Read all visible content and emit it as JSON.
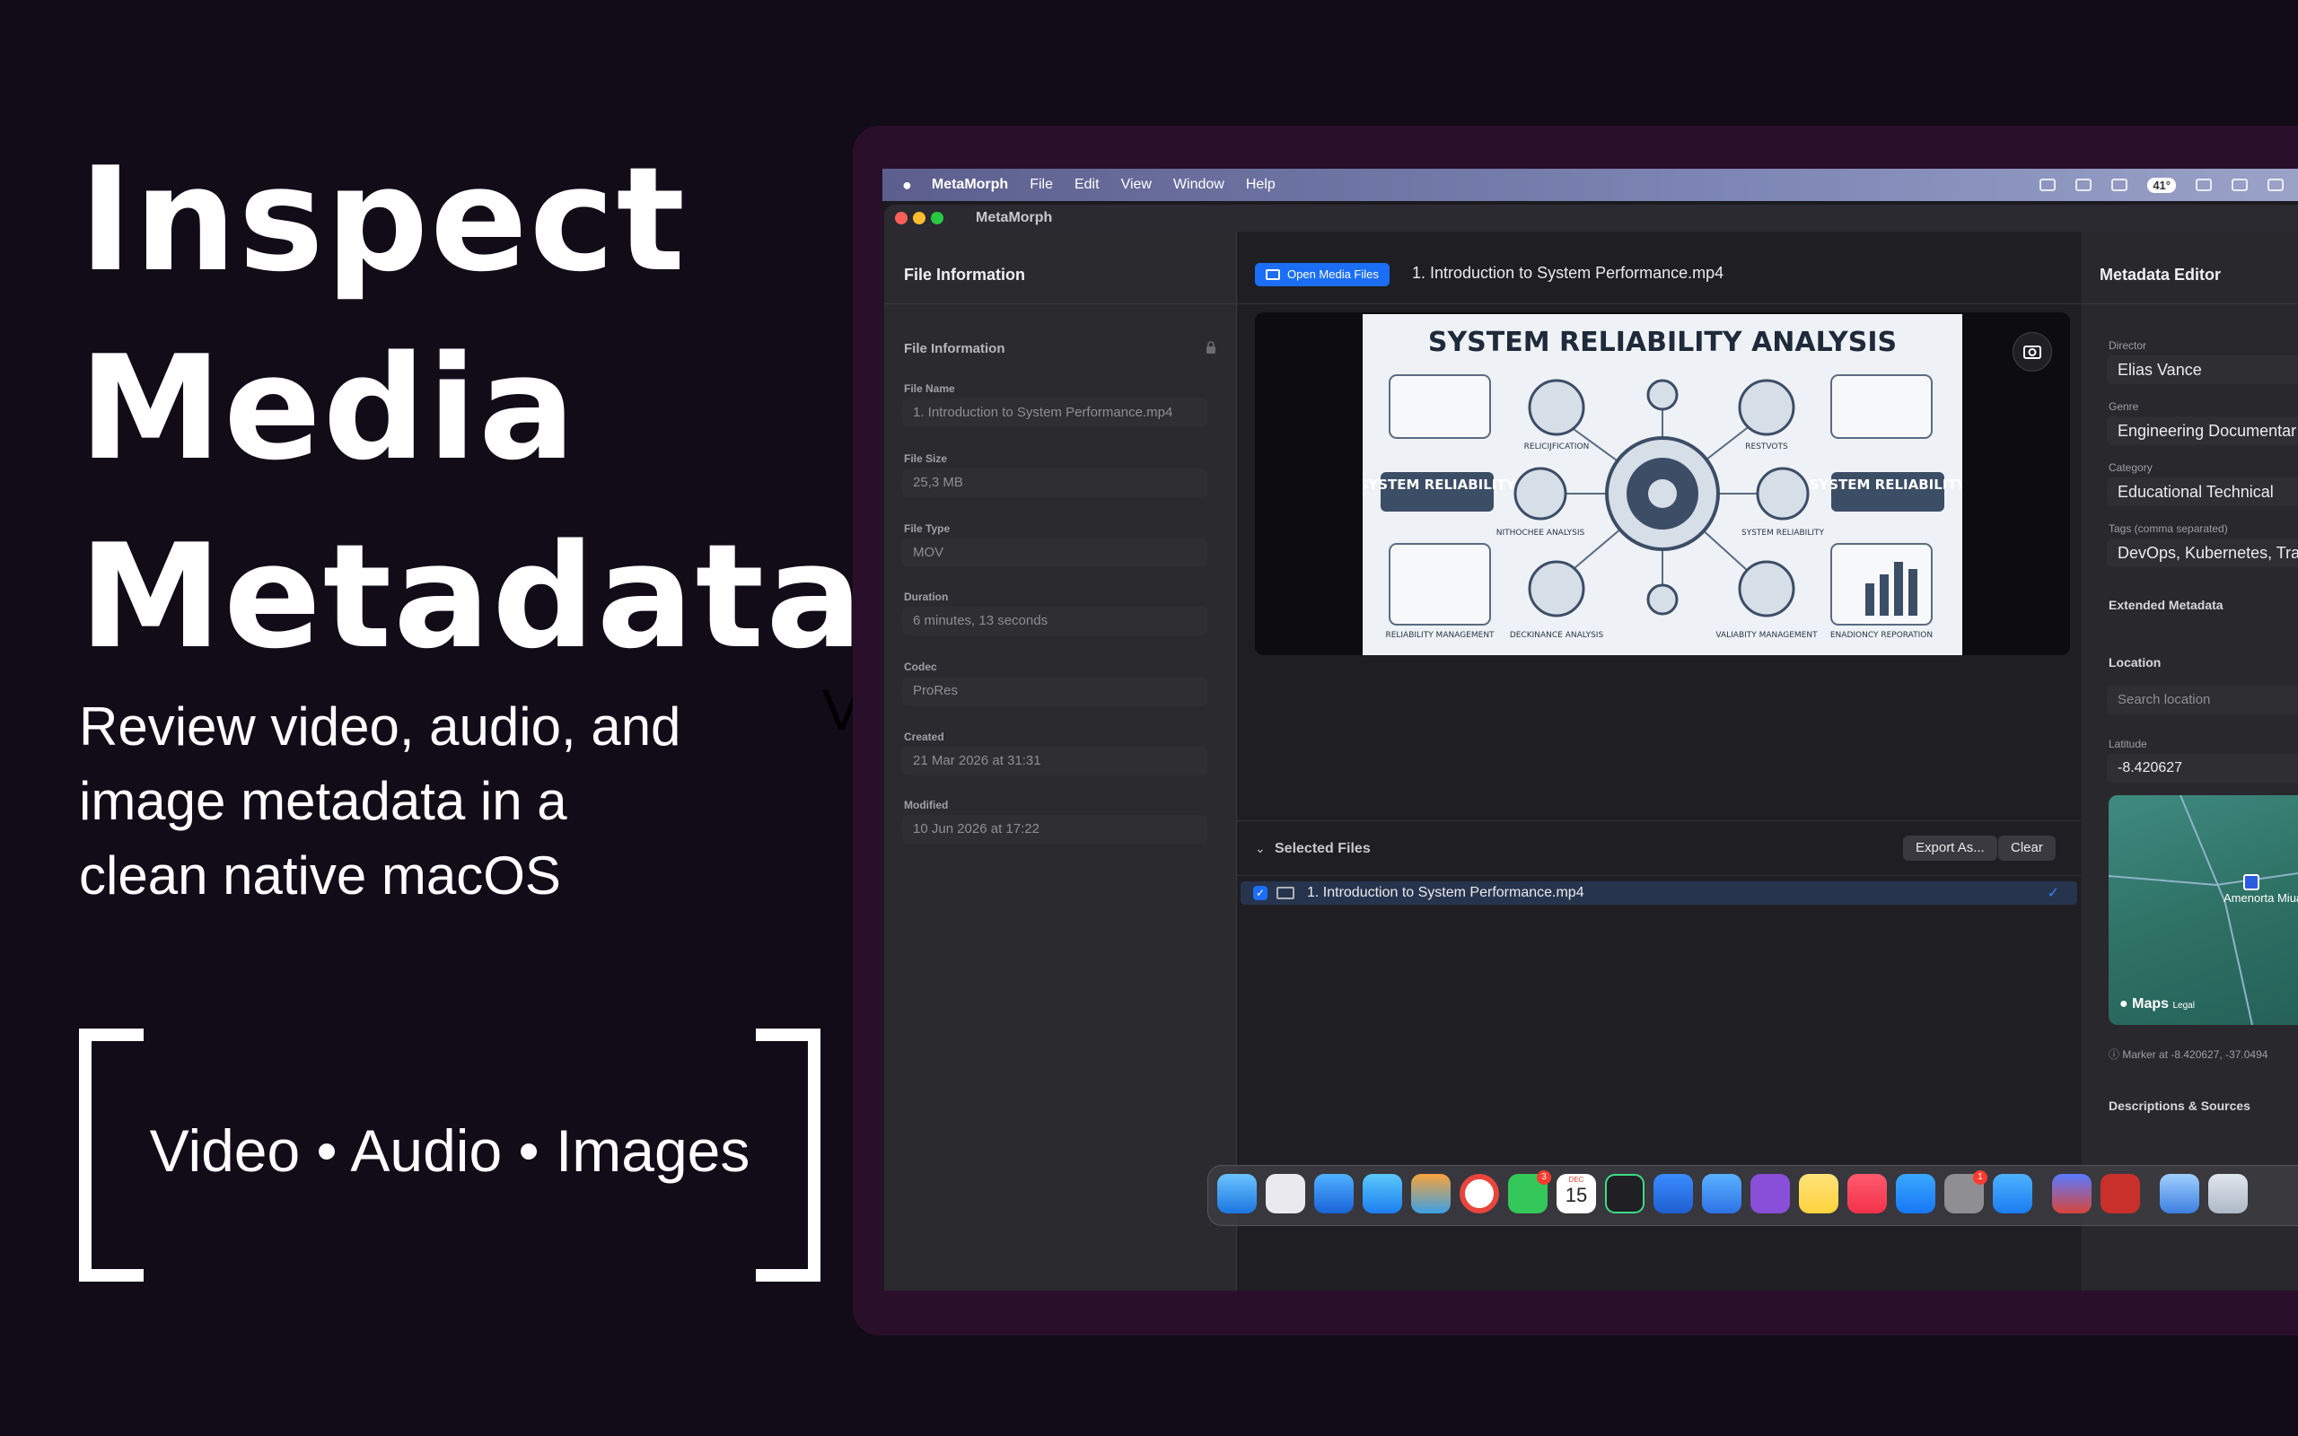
{
  "hero": {
    "headline": [
      "Inspect",
      "Media",
      "Metadata"
    ],
    "subtitle": [
      "Review video, audio, and",
      "image metadata in a",
      "clean native macOS"
    ],
    "ghost_text": "Vi",
    "tagline": "Video • Audio • Images"
  },
  "menubar": {
    "app_name": "MetaMorph",
    "menus": [
      "File",
      "Edit",
      "View",
      "Window",
      "Help"
    ],
    "temperature": "41°"
  },
  "window": {
    "title": "MetaMorph"
  },
  "file_info": {
    "pane_title": "File Information",
    "section_title": "File Information",
    "fields": [
      {
        "label": "File Name",
        "value": "1. Introduction to System Performance.mp4"
      },
      {
        "label": "File Size",
        "value": "25,3 MB"
      },
      {
        "label": "File Type",
        "value": "MOV"
      },
      {
        "label": "Duration",
        "value": "6 minutes, 13 seconds"
      },
      {
        "label": "Codec",
        "value": "ProRes"
      },
      {
        "label": "Created",
        "value": "21 Mar 2026 at 31:31"
      },
      {
        "label": "Modified",
        "value": "10 Jun 2026 at 17:22"
      }
    ]
  },
  "toolbar": {
    "open_label": "Open Media Files",
    "current_file": "1. Introduction to System Performance.mp4"
  },
  "preview": {
    "slide_title": "SYSTEM RELIABILITY ANALYSIS",
    "labels": {
      "left_box": "SYSTEM RELIABILITY",
      "right_box": "SYSTEM RELIABILITY",
      "reliification": "RELICIJFICATION",
      "restvots": "RESTVOTS",
      "nithochee": "NITHOCHEE ANALYSIS",
      "sys_rel_small": "SYSTEM RELIABILITY",
      "reliability_mgmt": "RELIABILITY MANAGEMENT",
      "deckinance": "DECKINANCE ANALYSIS",
      "valiabity": "VALIABITY MANAGEMENT",
      "enadioncy": "ENADIONCY REPORATION"
    }
  },
  "selected_files": {
    "title": "Selected Files",
    "export_label": "Export As...",
    "clear_label": "Clear",
    "items": [
      "1. Introduction to System Performance.mp4"
    ]
  },
  "inspector": {
    "title": "Metadata Editor",
    "fields": [
      {
        "label": "Director",
        "value": "Elias Vance"
      },
      {
        "label": "Genre",
        "value": "Engineering Documentar"
      },
      {
        "label": "Category",
        "value": "Educational Technical"
      },
      {
        "label": "Tags (comma separated)",
        "value": "DevOps, Kubernetes, Tra"
      }
    ],
    "extended_title": "Extended Metadata",
    "location_title": "Location",
    "search_placeholder": "Search location",
    "latitude_label": "Latitude",
    "latitude_value": "-8.420627",
    "map_place": "Amenorta Miuari",
    "maps_brand": "Maps",
    "maps_legal": "Legal",
    "marker_info": "Marker at -8.420627, -37.0494",
    "descriptions_title": "Descriptions & Sources"
  },
  "dock": {
    "calendar_day": "15",
    "calendar_month": "DEC",
    "messages_badge": "3",
    "settings_badge": "1"
  }
}
